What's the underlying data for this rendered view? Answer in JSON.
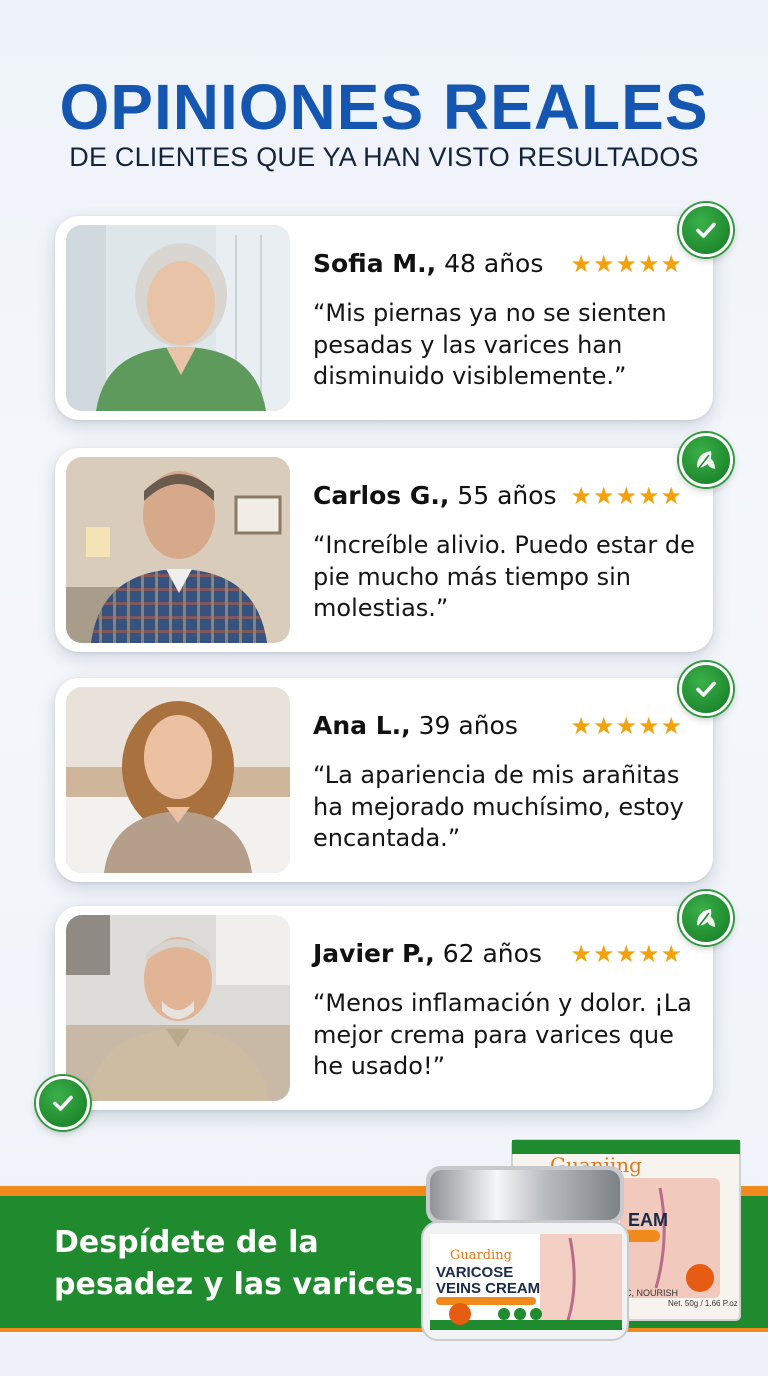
{
  "header": {
    "title": "OPINIONES REALES",
    "subtitle": "DE CLIENTES QUE YA HAN VISTO RESULTADOS"
  },
  "colors": {
    "brand_blue": "#1456b0",
    "green": "#1f8a2e",
    "orange": "#f08a1c",
    "star": "#f2a20c"
  },
  "testimonials": [
    {
      "name": "Sofia M.,",
      "age": "48 años",
      "stars": "★★★★★",
      "rating": 5,
      "quote": "“Mis piernas ya no se sienten pesadas y las varices han disminuido visiblemente.”",
      "badge_icon": "check-icon"
    },
    {
      "name": "Carlos G.,",
      "age": "55 años",
      "stars": "★★★★★",
      "rating": 5,
      "quote": "“Increíble alivio. Puedo estar de pie mucho más tiempo sin molestias.”",
      "badge_icon": "leaf-icon"
    },
    {
      "name": "Ana L.,",
      "age": "39 años",
      "stars": "★★★★★",
      "rating": 5,
      "quote": "“La apariencia de mis arañitas ha mejorado muchísimo, estoy encantada.”",
      "badge_icon": "check-icon"
    },
    {
      "name": "Javier P.,",
      "age": "62 años",
      "stars": "★★★★★",
      "rating": 5,
      "quote": "“Menos inflamación y dolor. ¡La mejor crema para varices que he usado!”",
      "badge_icon": "leaf-icon"
    }
  ],
  "footer": {
    "tagline_line1": "Despídete de la",
    "tagline_line2": "pesadez y las varices."
  },
  "product": {
    "brand": "Guanjing",
    "jar_brand": "Guarding",
    "name_line1": "VARICOSE",
    "name_line2": "VEINS CREAM",
    "box_word": "EAM",
    "net": "Net. 50g / 1.66 P.oz",
    "box_side": "C, NOURISH"
  }
}
